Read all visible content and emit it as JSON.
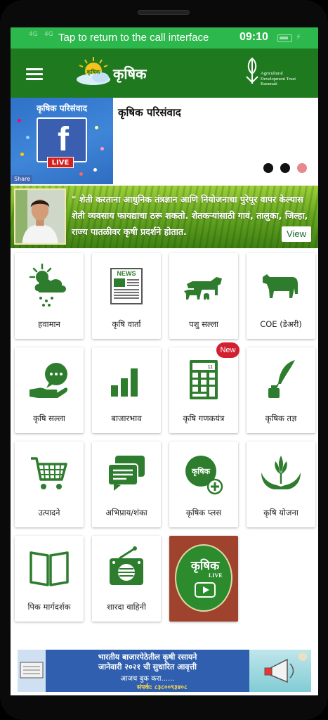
{
  "status_bar": {
    "signal_1": "4G",
    "signal_2": "4G",
    "message": "Tap to return to the call interface",
    "time": "09:10"
  },
  "app_bar": {
    "title": "कृषिक",
    "logo_text": "कृषिक",
    "org_name_line1": "Agricultural",
    "org_name_line2": "Development Trust",
    "org_name_line3": "Baramati"
  },
  "banner": {
    "thumbnail_title": "कृषिक परिसंवाद",
    "thumbnail_live": "LIVE",
    "thumbnail_share": "Share",
    "title": "कृषिक परिसंवाद",
    "active_page": 3,
    "page_count": 3
  },
  "quote": {
    "text": "\" शेती करताना आधुनिक तंत्रज्ञान आणि नियोजनाचा पुरेपूर वापर केल्यास शेती व्यवसाय फायद्याचा ठरू शकतो. शेतकऱ्यांसाठी गावं, तालुका, जिल्हा, राज्य पातळीवर कृषी प्रदर्शने होतात.",
    "view_label": "View"
  },
  "menu": {
    "tiles": [
      {
        "label": "हवामान",
        "icon": "weather-icon"
      },
      {
        "label": "कृषि वार्ता",
        "icon": "newspaper-icon"
      },
      {
        "label": "पशु सल्ला",
        "icon": "livestock-icon"
      },
      {
        "label": "COE (डेअरी)",
        "icon": "cow-icon"
      },
      {
        "label": "कृषि सल्ला",
        "icon": "advice-icon"
      },
      {
        "label": "बाजारभाव",
        "icon": "bar-chart-icon"
      },
      {
        "label": "कृषि गणकयंत्र",
        "icon": "calculator-icon",
        "badge": "New"
      },
      {
        "label": "कृषिक तज्ञ",
        "icon": "quill-icon"
      },
      {
        "label": "उत्पादने",
        "icon": "cart-icon"
      },
      {
        "label": "अभिप्राय/शंका",
        "icon": "chat-icon"
      },
      {
        "label": "कृषिक प्लस",
        "icon": "krushik-plus-icon",
        "logo_text": "कृषिक"
      },
      {
        "label": "कृषि योजना",
        "icon": "hands-wheat-icon"
      },
      {
        "label": "पिक मार्गदर्शक",
        "icon": "book-icon"
      },
      {
        "label": "शारदा वाहिनी",
        "icon": "radio-icon"
      },
      {
        "label": "",
        "icon": "krushik-live-icon",
        "logo_text": "कृषिक",
        "live_text": "LIVE"
      }
    ]
  },
  "ad": {
    "line1": "भारतीय बाजारपेठेतील कृषी रसायने",
    "line2": "जानेवारी २०२१ ची सुधारित आवृत्ती",
    "line3": "आजच बुक करा......",
    "line4": "संपर्क: ८३८००९३४०८"
  },
  "colors": {
    "status_bar": "#2db84d",
    "app_bar": "#1f7a1f",
    "icon_green": "#2e7d2e",
    "pager_active": "#e8888c",
    "badge": "#d32030"
  }
}
